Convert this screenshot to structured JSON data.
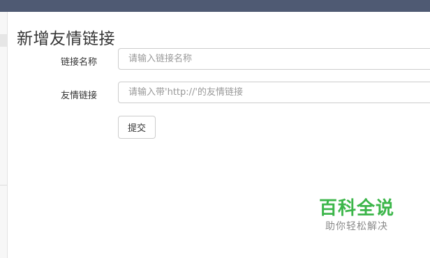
{
  "page": {
    "title": "新增友情链接"
  },
  "form": {
    "name_label": "链接名称",
    "name_placeholder": "请输入链接名称",
    "url_label": "友情链接",
    "url_placeholder": "请输入带'http://'的友情链接",
    "submit_label": "提交"
  },
  "watermark": {
    "title": "百科全说",
    "subtitle": "助你轻松解决"
  },
  "colors": {
    "topbar": "#4f5a73",
    "watermark_green": "#3cb64a"
  }
}
